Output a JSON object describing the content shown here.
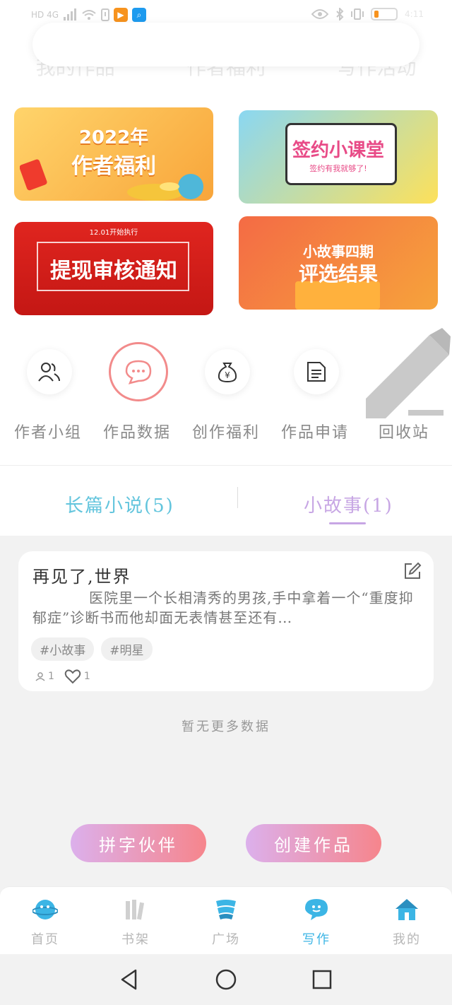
{
  "status_bar": {
    "network": "HD 4G",
    "time": "4:11",
    "battery_level": 0.2,
    "colors": {
      "battery": "#f7931e",
      "app_badge_1": "#f7931e",
      "app_badge_2": "#1e9bef"
    }
  },
  "top_nav": {
    "tabs": [
      "我的作品",
      "作者福利",
      "写作活动"
    ]
  },
  "banners": {
    "welfare": {
      "line1": "2022年",
      "line2": "作者福利"
    },
    "contract": {
      "line1": "签约小课堂",
      "line2": "签约有我就够了!"
    },
    "withdraw": {
      "line0": "12.01开始执行",
      "line1": "提现审核通知"
    },
    "story": {
      "line1": "小故事四期",
      "line2": "评选结果"
    }
  },
  "quick_actions": [
    {
      "label": "作者小组",
      "icon": "group-icon"
    },
    {
      "label": "作品数据",
      "icon": "chat-icon"
    },
    {
      "label": "创作福利",
      "icon": "money-bag-icon"
    },
    {
      "label": "作品申请",
      "icon": "document-icon"
    },
    {
      "label": "回收站",
      "icon": "pencil-icon"
    }
  ],
  "content_tabs": {
    "novel": "长篇小说(5)",
    "short_story": "小故事(1)",
    "active": "short_story"
  },
  "story": {
    "title": "再见了,世界",
    "excerpt": "医院里一个长相清秀的男孩,手中拿着一个“重度抑郁症”诊断书而他却面无表情甚至还有…",
    "tags": [
      "#小故事",
      "#明星"
    ],
    "views": "1",
    "likes": "1"
  },
  "no_more_text": "暂无更多数据",
  "buttons": {
    "partner": "拼字伙伴",
    "create": "创建作品"
  },
  "bottom_nav": [
    {
      "label": "首页",
      "icon": "planet-icon"
    },
    {
      "label": "书架",
      "icon": "bookshelf-icon"
    },
    {
      "label": "广场",
      "icon": "square-icon"
    },
    {
      "label": "写作",
      "icon": "write-chat-icon"
    },
    {
      "label": "我的",
      "icon": "home-icon"
    }
  ],
  "colors": {
    "accent_blue": "#3cb5e5",
    "tab_novel": "#63c5dd",
    "tab_story": "#c7a6e4",
    "button_gradient_start": "#dcb0ec",
    "button_gradient_end": "#f6858c"
  }
}
